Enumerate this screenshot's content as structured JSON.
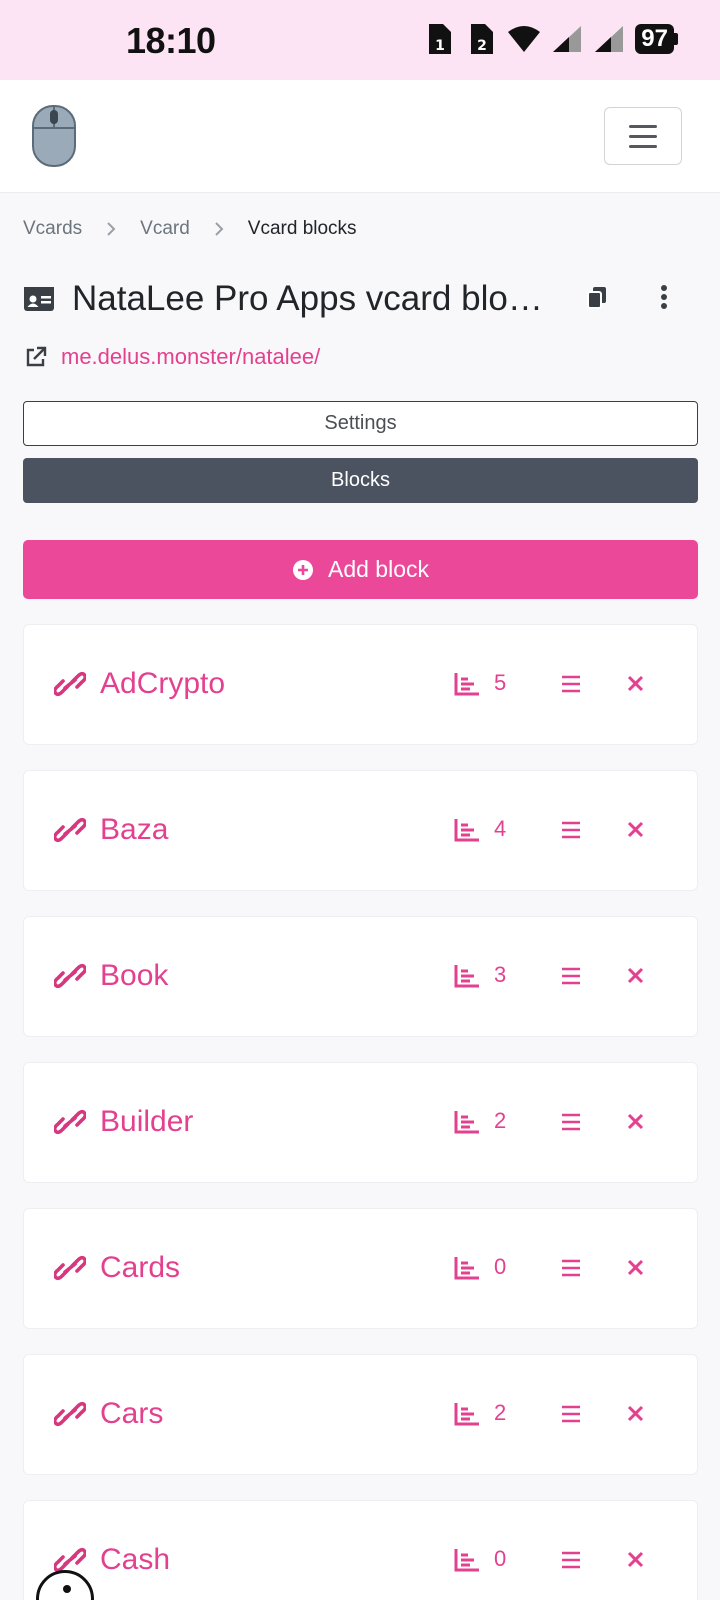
{
  "statusbar": {
    "time": "18:10",
    "battery": "97"
  },
  "breadcrumb": {
    "items": [
      "Vcards",
      "Vcard",
      "Vcard blocks"
    ]
  },
  "page": {
    "title": "NataLee Pro Apps vcard blocks",
    "url": "me.delus.monster/natalee/"
  },
  "tabs": {
    "settings": "Settings",
    "blocks": "Blocks"
  },
  "add_block_label": "Add block",
  "blocks": [
    {
      "name": "AdCrypto",
      "count": "5"
    },
    {
      "name": "Baza",
      "count": "4"
    },
    {
      "name": "Book",
      "count": "3"
    },
    {
      "name": "Builder",
      "count": "2"
    },
    {
      "name": "Cards",
      "count": "0"
    },
    {
      "name": "Cars",
      "count": "2"
    },
    {
      "name": "Cash",
      "count": "0"
    }
  ],
  "colors": {
    "accent": "#ec4899",
    "link": "#e3418f",
    "statusbar": "#fce4f4",
    "active_tab": "#4b5361"
  }
}
